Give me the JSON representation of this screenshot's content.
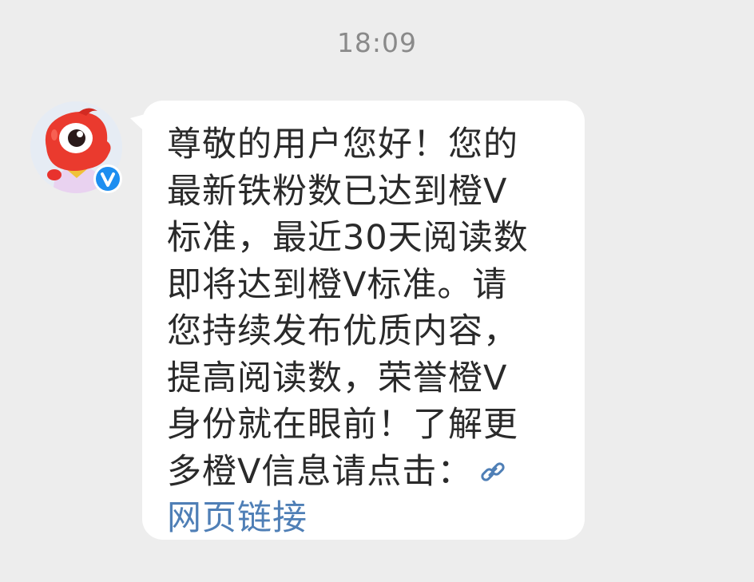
{
  "timestamp": "18:09",
  "sender": {
    "avatar_icon": "mascot-avatar-icon",
    "badge_icon": "verified-v-badge-icon",
    "badge_letter": "V",
    "badge_color": "#1d8ef0"
  },
  "message": {
    "lines": [
      "尊敬的用户您好！您的",
      "最新铁粉数已达到橙V",
      "标准，最近30天阅读数",
      "即将达到橙V标准。请",
      "您持续发布优质内容，",
      "提高阅读数，荣誉橙V",
      "身份就在眼前！了解更",
      "多橙V信息请点击："
    ],
    "link_icon": "link-chain-icon",
    "link_label": "网页链接",
    "link_color": "#4f7fb6"
  },
  "colors": {
    "background": "#ededed",
    "bubble": "#ffffff",
    "text": "#2a2a2a",
    "timestamp": "#8a8a8a"
  }
}
